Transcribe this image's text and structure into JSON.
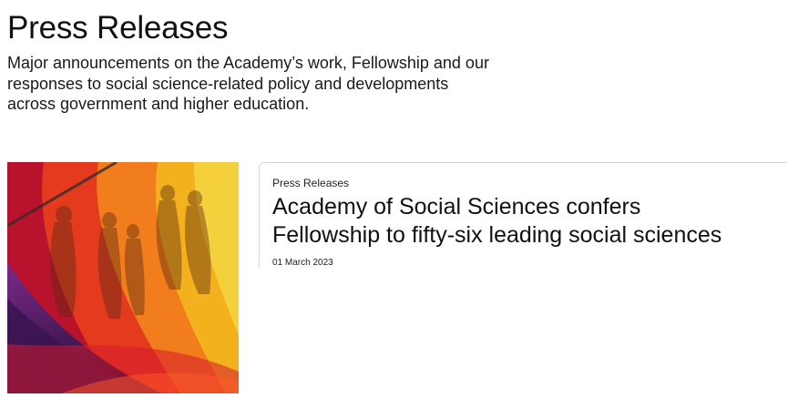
{
  "header": {
    "title": "Press Releases",
    "intro_lines": [
      "Major announcements on the Academy’s work, Fellowship and our",
      "responses to social science-related policy and developments",
      "across government and higher education."
    ]
  },
  "articles": [
    {
      "category": "Press Releases",
      "title_lines": [
        "Academy of Social Sciences confers",
        "Fellowship to fifty-six leading social sciences"
      ],
      "date": "01 March 2023",
      "image_icon": "colorful-fabric-shadows-photo"
    }
  ],
  "colors": {
    "text": "#111111",
    "border": "#d8d8d8",
    "image_palette": [
      "#3a1450",
      "#b0102a",
      "#e8381c",
      "#f07a1c",
      "#f3b21c",
      "#f2d23a"
    ]
  }
}
